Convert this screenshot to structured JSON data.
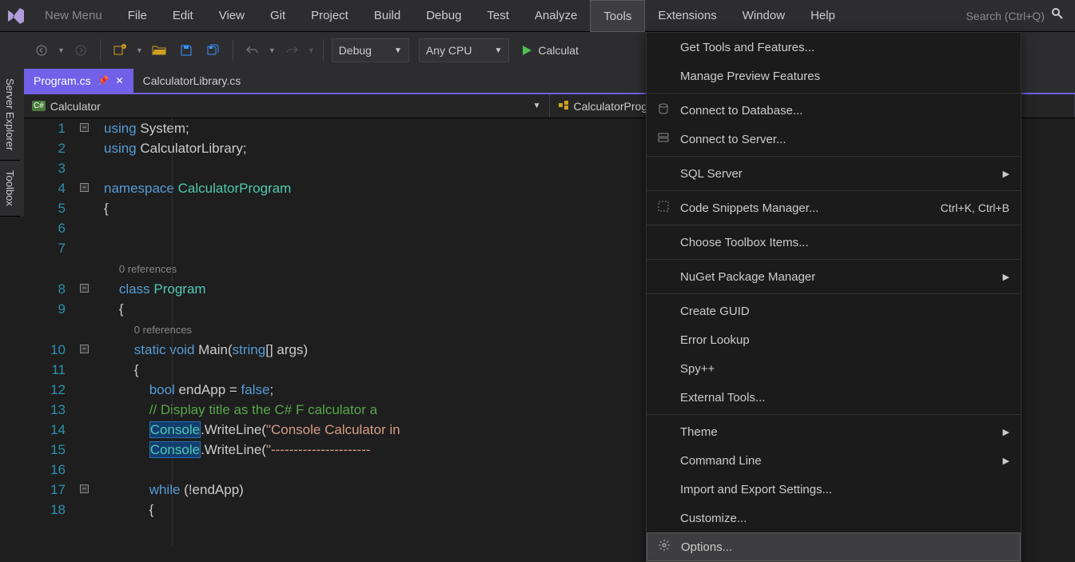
{
  "menu": [
    "New Menu",
    "File",
    "Edit",
    "View",
    "Git",
    "Project",
    "Build",
    "Debug",
    "Test",
    "Analyze",
    "Tools",
    "Extensions",
    "Window",
    "Help"
  ],
  "menu_active_index": 10,
  "search_placeholder": "Search (Ctrl+Q)",
  "toolbar": {
    "config": "Debug",
    "platform": "Any CPU",
    "run_label": "Calculat"
  },
  "tabs": [
    {
      "label": "Program.cs",
      "active": true
    },
    {
      "label": "CalculatorLibrary.cs",
      "active": false
    }
  ],
  "nav": {
    "left": {
      "icon": "C#",
      "label": "Calculator"
    },
    "right": {
      "label": "CalculatorProgram.Program"
    }
  },
  "side_tabs": [
    "Server Explorer",
    "Toolbox"
  ],
  "code": {
    "references_label": "0 references",
    "lines": [
      {
        "n": 1,
        "fold": "-",
        "html": "<span class='kw'>using</span> System;"
      },
      {
        "n": 2,
        "html": "<span class='kw'>using</span> CalculatorLibrary;"
      },
      {
        "n": 3,
        "html": ""
      },
      {
        "n": 4,
        "fold": "-",
        "html": "<span class='kw'>namespace</span> <span class='cls'>CalculatorProgram</span>"
      },
      {
        "n": 5,
        "html": "{"
      },
      {
        "n": 6,
        "html": ""
      },
      {
        "n": 7,
        "html": ""
      },
      {
        "n": "ref",
        "html": "    <span class='ref'>0 references</span>"
      },
      {
        "n": 8,
        "fold": "-",
        "html": "    <span class='kw'>class</span> <span class='cls'>Program</span>"
      },
      {
        "n": 9,
        "html": "    {"
      },
      {
        "n": "ref",
        "html": "        <span class='ref'>0 references</span>"
      },
      {
        "n": 10,
        "fold": "-",
        "html": "        <span class='kw'>static</span> <span class='kw'>void</span> Main(<span class='kw'>string</span>[] args)"
      },
      {
        "n": 11,
        "html": "        {"
      },
      {
        "n": 12,
        "html": "            <span class='kw'>bool</span> endApp = <span class='kw'>false</span>;"
      },
      {
        "n": 13,
        "html": "            <span class='com'>// Display title as the C# F calculator a</span>"
      },
      {
        "n": 14,
        "html": "            <span class='hl cls'>Console</span>.WriteLine(<span class='str'>\"Console Calculator in </span>"
      },
      {
        "n": 15,
        "html": "            <span class='hl cls'>Console</span>.WriteLine(<span class='str'>\"----------------------</span>"
      },
      {
        "n": 16,
        "html": ""
      },
      {
        "n": 17,
        "fold": "-",
        "html": "            <span class='kw'>while</span> (!endApp)"
      },
      {
        "n": 18,
        "html": "            {"
      }
    ]
  },
  "dropdown": [
    {
      "label": "Get Tools and Features..."
    },
    {
      "label": "Manage Preview Features"
    },
    {
      "sep": true
    },
    {
      "icon": "db",
      "label": "Connect to Database..."
    },
    {
      "icon": "srv",
      "label": "Connect to Server..."
    },
    {
      "sep": true
    },
    {
      "label": "SQL Server",
      "sub": true
    },
    {
      "sep": true
    },
    {
      "icon": "snip",
      "label": "Code Snippets Manager...",
      "shortcut": "Ctrl+K, Ctrl+B"
    },
    {
      "sep": true
    },
    {
      "label": "Choose Toolbox Items..."
    },
    {
      "sep": true
    },
    {
      "label": "NuGet Package Manager",
      "sub": true
    },
    {
      "sep": true
    },
    {
      "label": "Create GUID"
    },
    {
      "label": "Error Lookup"
    },
    {
      "label": "Spy++"
    },
    {
      "label": "External Tools..."
    },
    {
      "sep": true
    },
    {
      "label": "Theme",
      "sub": true
    },
    {
      "label": "Command Line",
      "sub": true
    },
    {
      "label": "Import and Export Settings..."
    },
    {
      "label": "Customize..."
    },
    {
      "icon": "gear",
      "label": "Options...",
      "selected": true
    }
  ]
}
